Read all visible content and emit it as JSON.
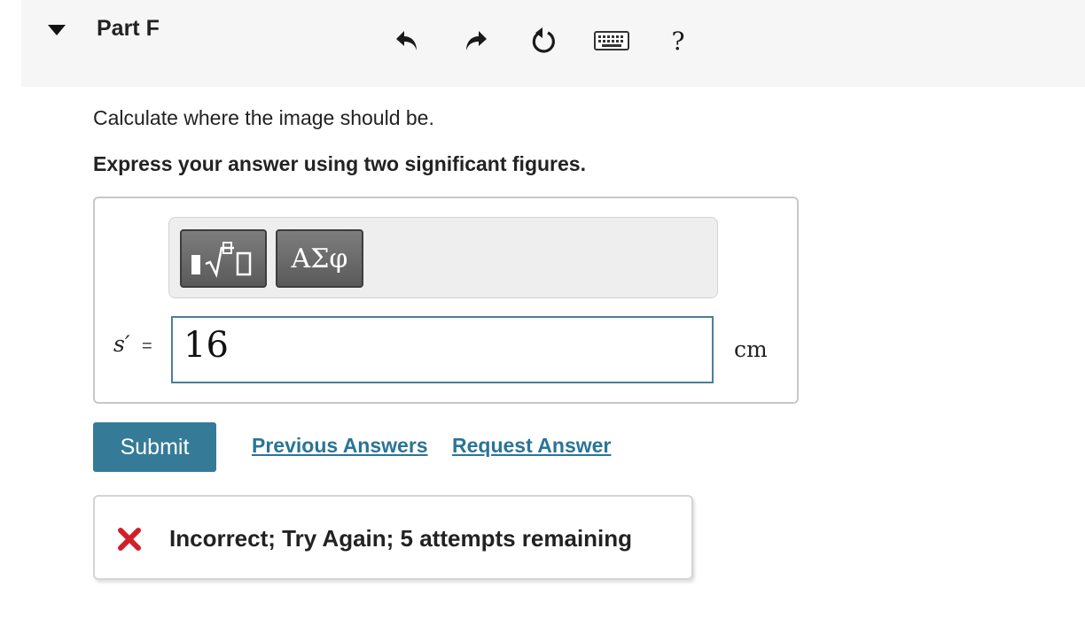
{
  "part": {
    "title": "Part F"
  },
  "question": {
    "text": "Calculate where the image should be.",
    "instruction": "Express your answer using two significant figures."
  },
  "toolbar": {
    "templates_icon": "templates-sqrt-icon",
    "greek_label": "ΑΣφ",
    "undo_icon": "undo-icon",
    "redo_icon": "redo-icon",
    "reset_icon": "reset-icon",
    "keyboard_icon": "keyboard-icon",
    "help_label": "?"
  },
  "answer": {
    "lhs": "s′",
    "equals": "=",
    "value": "16",
    "unit": "cm"
  },
  "actions": {
    "submit_label": "Submit",
    "previous_answers_label": "Previous Answers",
    "request_answer_label": "Request Answer"
  },
  "feedback": {
    "icon": "incorrect-x-icon",
    "text": "Incorrect; Try Again; 5 attempts remaining"
  },
  "colors": {
    "accent": "#357b97",
    "link": "#2a7497",
    "error": "#d0202a",
    "header_bg": "#f6f6f6"
  }
}
